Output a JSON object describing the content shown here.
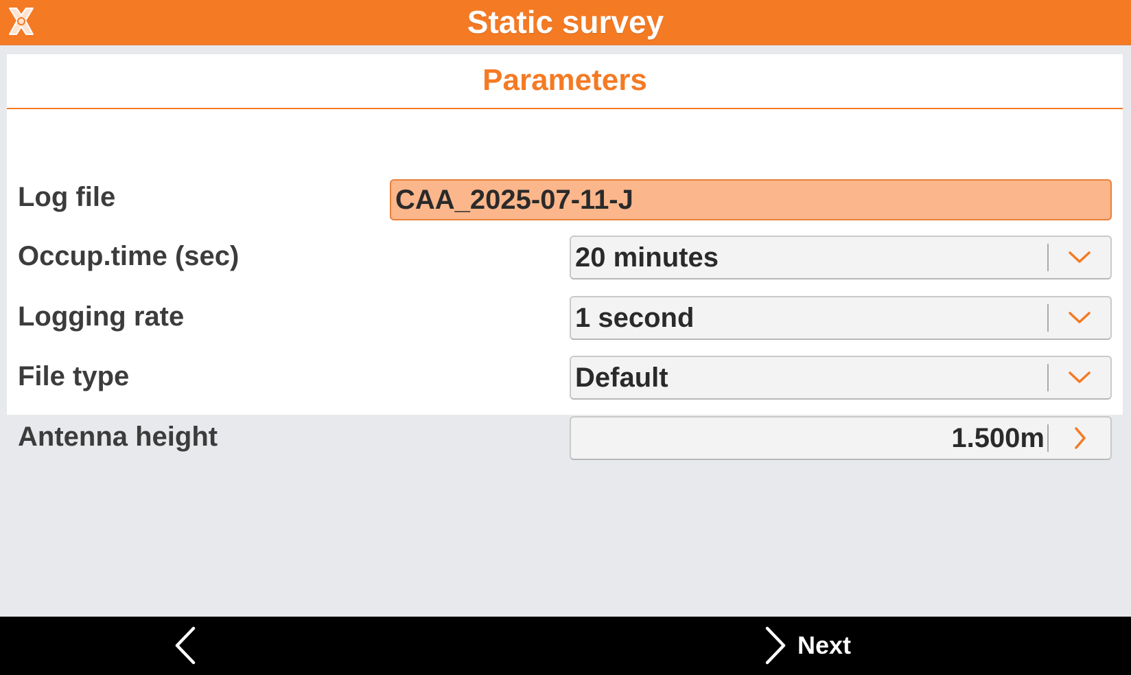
{
  "window": {
    "title": "Static survey"
  },
  "colors": {
    "accent": "#f47a24",
    "input_highlight": "#fbb68b",
    "background": "#e8e9ec",
    "nav_bar": "#000000"
  },
  "panel": {
    "heading": "Parameters",
    "fields": {
      "log_file": {
        "label": "Log file",
        "value": "CAA_2025-07-11-J"
      },
      "occup_time": {
        "label": "Occup.time (sec)",
        "value": "20 minutes",
        "icon": "chevron-down-icon"
      },
      "logging_rate": {
        "label": "Logging rate",
        "value": "1 second",
        "icon": "chevron-down-icon"
      },
      "file_type": {
        "label": "File type",
        "value": "Default",
        "icon": "chevron-down-icon"
      },
      "antenna_height": {
        "label": "Antenna height",
        "value": "1.500m",
        "icon": "chevron-right-icon"
      }
    }
  },
  "footer": {
    "back_icon": "chevron-left-icon",
    "next_icon": "chevron-right-icon",
    "next_label": "Next"
  }
}
